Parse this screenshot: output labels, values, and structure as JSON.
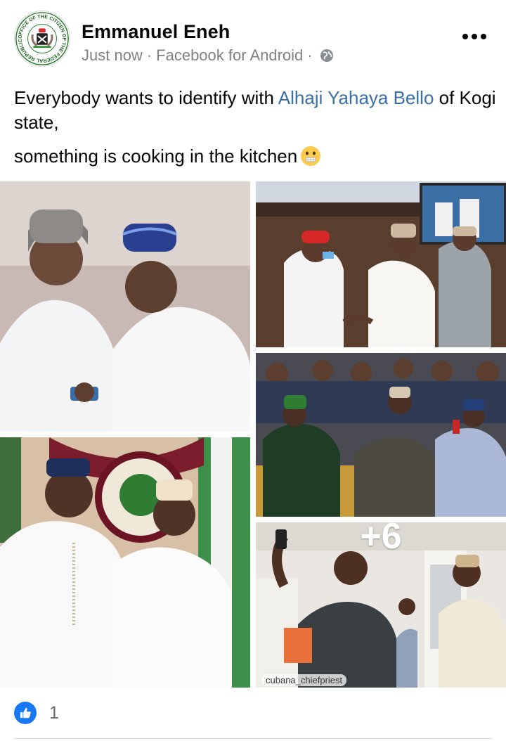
{
  "post": {
    "author": "Emmanuel Eneh",
    "time": "Just now",
    "source": "Facebook for Android",
    "separator": "·",
    "avatar": {
      "ring_text": "OFFICE OF THE CITIZEN OF THE FEDERAL REPUBLIC OF NIGERIA",
      "icon": "coat-of-arms-seal"
    },
    "privacy_icon": "globe-icon",
    "menu_icon": "more-options-icon",
    "text": {
      "line1_before": "Everybody wants to identify with",
      "mention": "Alhaji Yahaya Bello",
      "line1_after": "of Kogi state,",
      "line2": "something is cooking in the kitchen",
      "emoji": "grimacing-face-with-bandage-mouth"
    }
  },
  "photos": {
    "more_count": "+6",
    "watermark": "cubana_chiefpriest",
    "items": [
      {
        "name": "two-men-looking-at-phone"
      },
      {
        "name": "handshake-in-office"
      },
      {
        "name": "two-men-in-front-of-kogi-seal"
      },
      {
        "name": "press-conference-meeting"
      },
      {
        "name": "selfie-at-entrance"
      }
    ]
  },
  "reactions": {
    "icon": "like-icon",
    "count": "1"
  },
  "colors": {
    "mention": "#3b6fa8",
    "like_blue": "#1877f2",
    "meta_gray": "#7f8183"
  }
}
